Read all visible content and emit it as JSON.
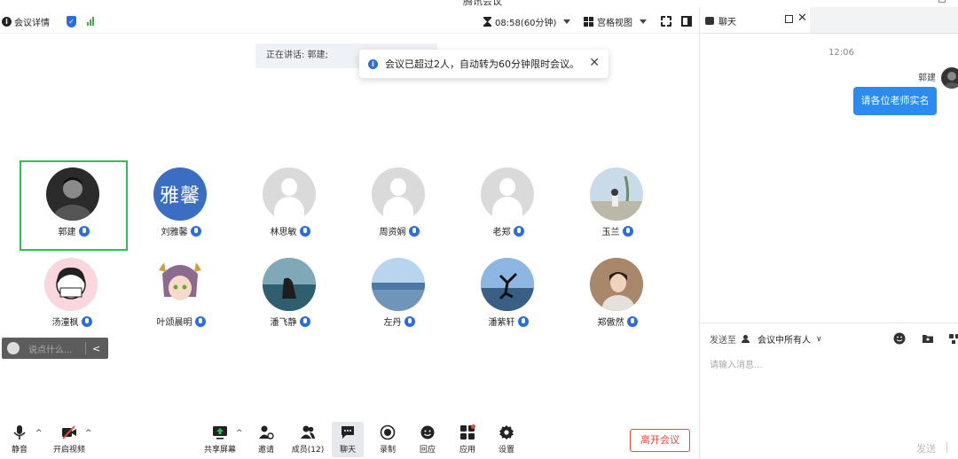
{
  "window": {
    "title": "腾讯会议"
  },
  "toolbar": {
    "meeting_info_label": "会议详情",
    "timer": "08:58(60分钟)",
    "view_mode_label": "宫格视图"
  },
  "speaking": {
    "text": "正在讲话: 郭建;"
  },
  "notification": {
    "text": "会议已超过2人，自动转为60分钟限时会议。"
  },
  "participants": [
    {
      "name": "郭建"
    },
    {
      "name": "刘雅馨",
      "avatar_text": "雅馨"
    },
    {
      "name": "林思敏"
    },
    {
      "name": "周资娴"
    },
    {
      "name": "老郑"
    },
    {
      "name": "玉兰"
    },
    {
      "name": "汤潼枫"
    },
    {
      "name": "叶颂晨明"
    },
    {
      "name": "潘飞静"
    },
    {
      "name": "左丹"
    },
    {
      "name": "潘紫轩"
    },
    {
      "name": "郑傲然"
    }
  ],
  "quick_chat": {
    "placeholder": "说点什么..."
  },
  "bottom_bar": {
    "mute_label": "静音",
    "video_label": "开启视频",
    "share_label": "共享屏幕",
    "invite_label": "邀请",
    "members_label": "成员(12)",
    "chat_label": "聊天",
    "record_label": "录制",
    "react_label": "回应",
    "apps_label": "应用",
    "settings_label": "设置",
    "leave_label": "离开会议"
  },
  "chat_panel": {
    "title": "聊天",
    "time": "12:06",
    "sender": "郭建",
    "message": "请各位老师实名",
    "send_to_label": "发送至",
    "recipient": "会议中所有人",
    "input_placeholder": "请输入消息...",
    "send_label": "发送"
  },
  "colors": {
    "accent": "#2a6de1",
    "active_border": "#2dc24f",
    "leave": "#e94b3c",
    "message_bubble": "#2c8bef"
  }
}
